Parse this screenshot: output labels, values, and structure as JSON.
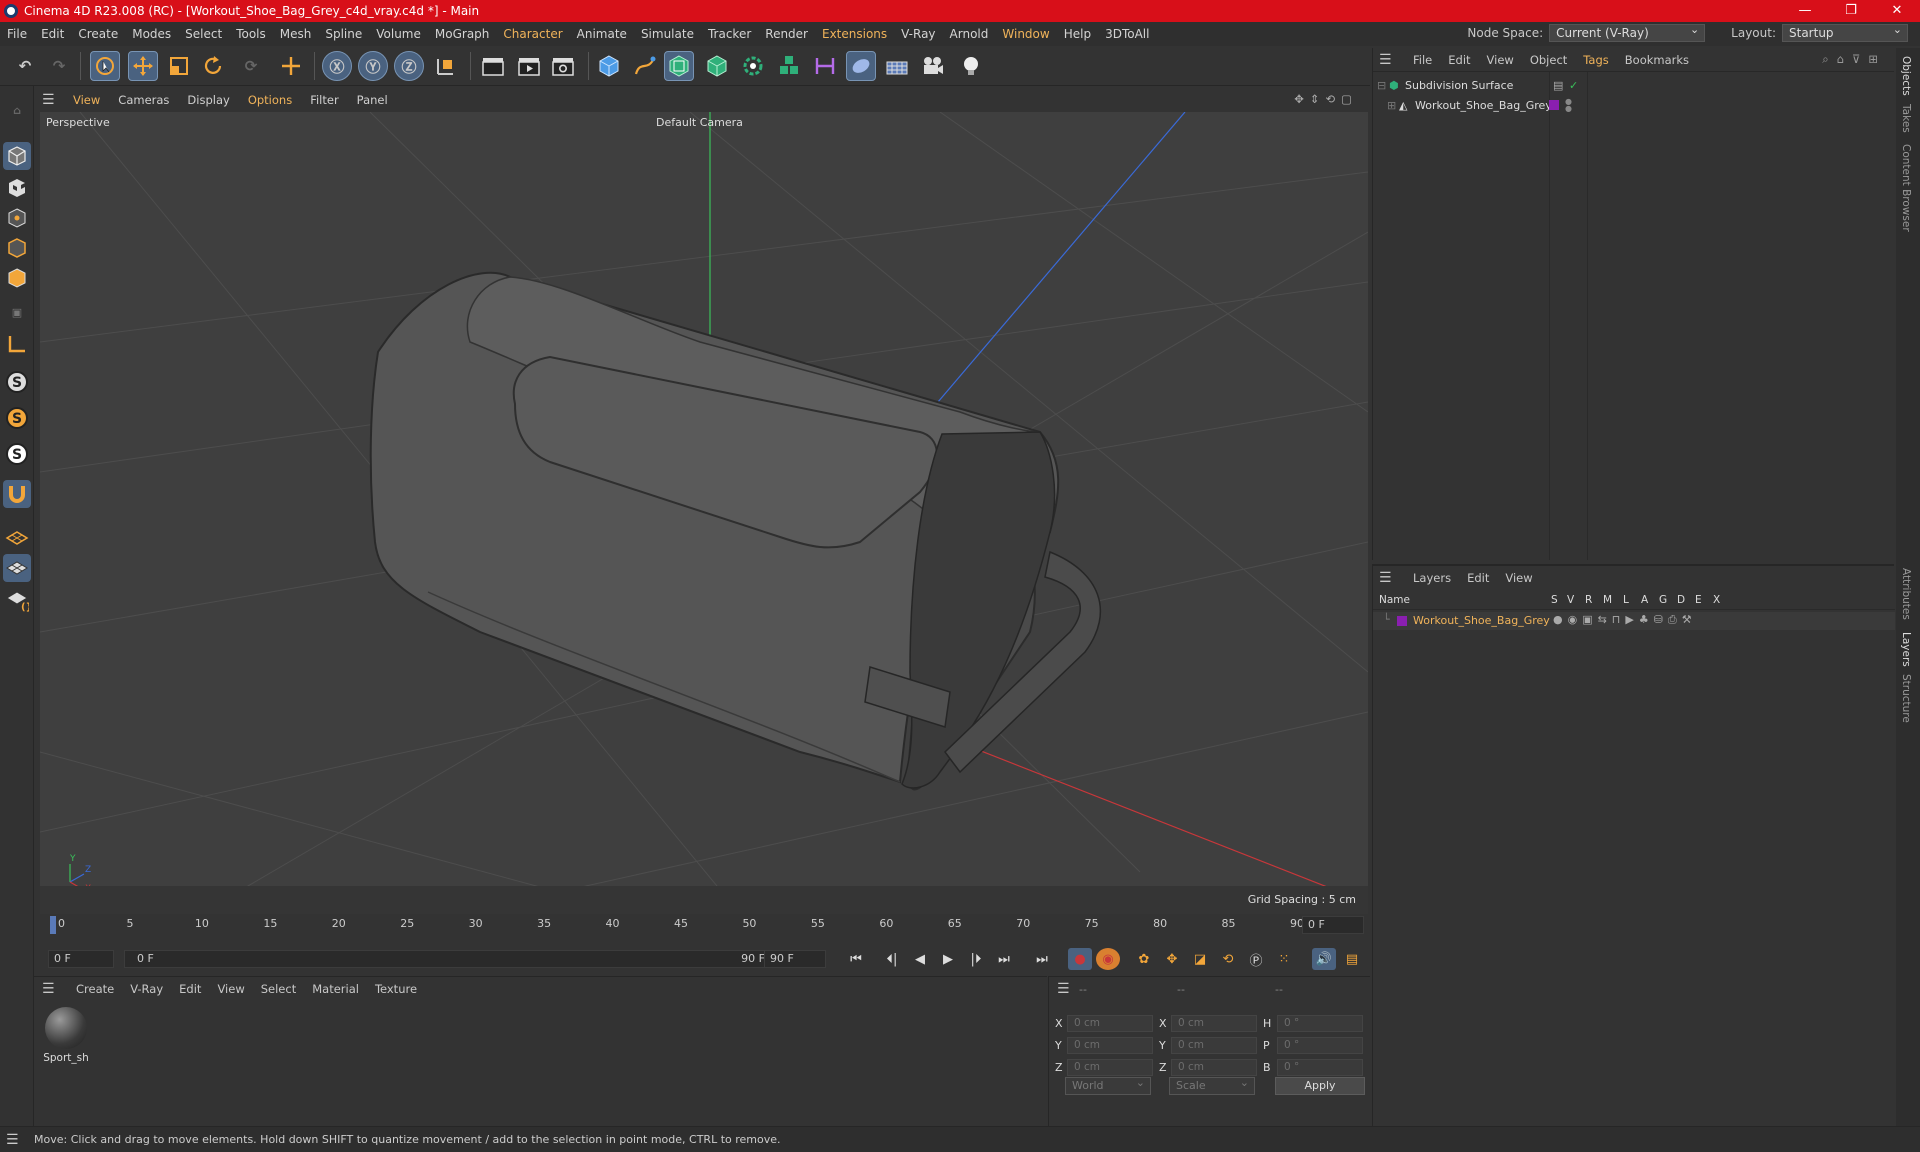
{
  "window": {
    "title": "Cinema 4D R23.008 (RC) - [Workout_Shoe_Bag_Grey_c4d_vray.c4d *] - Main",
    "controls": [
      "—",
      "❐",
      "✕"
    ]
  },
  "menubar": {
    "items": [
      "File",
      "Edit",
      "Create",
      "Modes",
      "Select",
      "Tools",
      "Mesh",
      "Spline",
      "Volume",
      "MoGraph",
      "Character",
      "Animate",
      "Simulate",
      "Tracker",
      "Render",
      "Extensions",
      "V-Ray",
      "Arnold",
      "Window",
      "Help",
      "3DToAll"
    ],
    "highlighted": [
      "Character",
      "Extensions",
      "Window"
    ],
    "node_space_label": "Node Space:",
    "node_space_value": "Current (V-Ray)",
    "layout_label": "Layout:",
    "layout_value": "Startup"
  },
  "viewport_menu": {
    "items": [
      "View",
      "Cameras",
      "Display",
      "Options",
      "Filter",
      "Panel"
    ],
    "highlighted": [
      "View",
      "Options"
    ]
  },
  "viewport": {
    "projection": "Perspective",
    "camera": "Default Camera",
    "grid_spacing": "Grid Spacing : 5 cm",
    "axis_labels": {
      "y": "Y",
      "z": "Z",
      "x": "X"
    }
  },
  "timeline": {
    "ticks": [
      "0",
      "5",
      "10",
      "15",
      "20",
      "25",
      "30",
      "35",
      "40",
      "45",
      "50",
      "55",
      "60",
      "65",
      "70",
      "75",
      "80",
      "85",
      "90"
    ],
    "current_frame_right": "0 F"
  },
  "playback": {
    "start_field": "0 F",
    "range_start": "0 F",
    "range_end": "90 F",
    "end_field": "90 F"
  },
  "material_manager": {
    "menu": [
      "Create",
      "V-Ray",
      "Edit",
      "View",
      "Select",
      "Material",
      "Texture"
    ],
    "materials": [
      {
        "name": "Sport_sh"
      }
    ]
  },
  "coordinates": {
    "header": [
      "--",
      "--",
      "--"
    ],
    "rows": [
      {
        "l1": "X",
        "v1": "0 cm",
        "l2": "X",
        "v2": "0 cm",
        "l3": "H",
        "v3": "0 °"
      },
      {
        "l1": "Y",
        "v1": "0 cm",
        "l2": "Y",
        "v2": "0 cm",
        "l3": "P",
        "v3": "0 °"
      },
      {
        "l1": "Z",
        "v1": "0 cm",
        "l2": "Z",
        "v2": "0 cm",
        "l3": "B",
        "v3": "0 °"
      }
    ],
    "mode_value": "World",
    "transform_value": "Scale",
    "apply_label": "Apply"
  },
  "object_manager": {
    "menu": [
      "File",
      "Edit",
      "View",
      "Object",
      "Tags",
      "Bookmarks"
    ],
    "highlighted": [
      "Tags"
    ],
    "objects": [
      {
        "name": "Subdivision Surface",
        "depth": 0
      },
      {
        "name": "Workout_Shoe_Bag_Grey",
        "depth": 1
      }
    ],
    "layer_color": "#8a1fb0"
  },
  "layer_manager": {
    "menu": [
      "Layers",
      "Edit",
      "View"
    ],
    "columns": [
      "Name",
      "S",
      "V",
      "R",
      "M",
      "L",
      "A",
      "G",
      "D",
      "E",
      "X"
    ],
    "layers": [
      {
        "name": "Workout_Shoe_Bag_Grey",
        "color": "#8a1fb0"
      }
    ]
  },
  "side_tabs": {
    "items": [
      "Objects",
      "Takes",
      "Content Browser",
      "Attributes",
      "Layers",
      "Structure"
    ],
    "active": [
      "Objects",
      "Layers"
    ]
  },
  "status": {
    "text": "Move: Click and drag to move elements. Hold down SHIFT to quantize movement / add to the selection in point mode, CTRL to remove."
  },
  "colors": {
    "titlebar": "#d80f19",
    "accent_orange": "#f0b35a",
    "axis_x": "#c8373a",
    "axis_y": "#3ac05a",
    "axis_z": "#3a6ad8"
  }
}
